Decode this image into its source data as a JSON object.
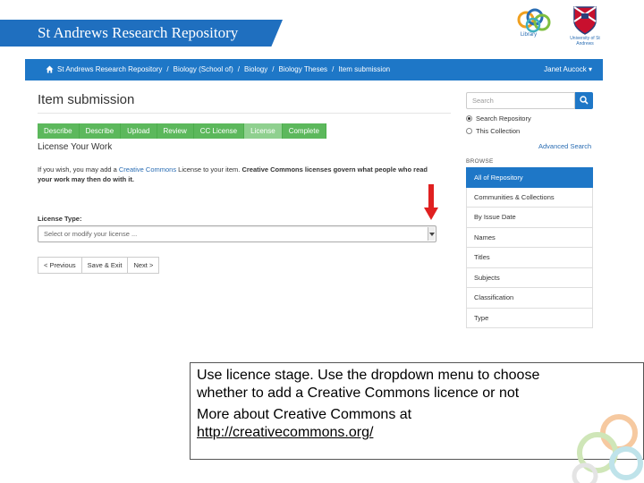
{
  "header": {
    "site_title": "St Andrews Research Repository",
    "library_logo_text": "Library",
    "university_logo_text": "University of St Andrews"
  },
  "nav": {
    "breadcrumbs": [
      "St Andrews Research Repository",
      "Biology (School of)",
      "Biology",
      "Biology Theses",
      "Item submission"
    ],
    "user_menu": "Janet Aucock"
  },
  "main": {
    "page_title": "Item submission",
    "steps": [
      "Describe",
      "Describe",
      "Upload",
      "Review",
      "CC License",
      "License",
      "Complete"
    ],
    "current_step_index": 5,
    "section_title": "License Your Work",
    "intro_text_before": "If you wish, you may add a ",
    "intro_link": "Creative Commons",
    "intro_text_middle": " License to your item. ",
    "intro_bold": "Creative Commons licenses govern what people who read your work may then do with it.",
    "license_label": "License Type:",
    "license_select_value": "Select or modify your license ...",
    "buttons": {
      "previous": "< Previous",
      "save_exit": "Save & Exit",
      "next": "Next >"
    }
  },
  "sidebar": {
    "search_placeholder": "Search",
    "search_scope_repository": "Search Repository",
    "search_scope_collection": "This Collection",
    "advanced_search": "Advanced Search",
    "browse_heading": "BROWSE",
    "browse_items": [
      "All of Repository",
      "Communities & Collections",
      "By Issue Date",
      "Names",
      "Titles",
      "Subjects",
      "Classification",
      "Type"
    ]
  },
  "caption": {
    "line1": "Use licence stage. Use the dropdown menu to choose",
    "line2": "whether to add a Creative Commons licence or not",
    "line3": "More about Creative Commons at",
    "link": "http://creativecommons.org/"
  },
  "colors": {
    "brand_blue": "#1e77c7",
    "step_green": "#5cb85c",
    "step_current": "#8fd08f",
    "arrow_red": "#e02020"
  }
}
